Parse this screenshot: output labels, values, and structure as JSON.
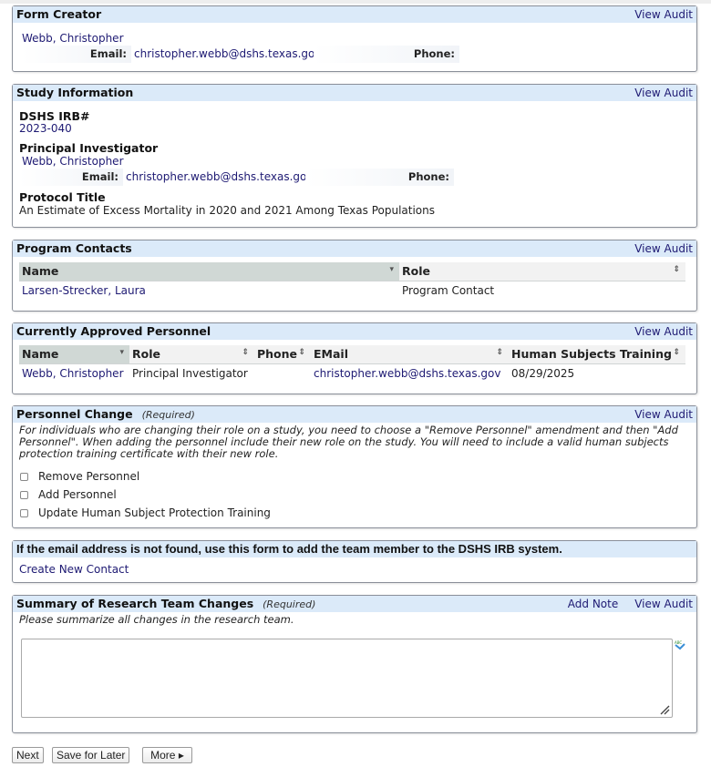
{
  "common": {
    "view_audit": "View Audit",
    "email_label": "Email:",
    "phone_label": "Phone:"
  },
  "form_creator": {
    "title": "Form Creator",
    "name": "Webb, Christopher",
    "email": "christopher.webb@dshs.texas.gov",
    "phone": ""
  },
  "study_info": {
    "title": "Study Information",
    "irb_label": "DSHS IRB#",
    "irb_value": "2023-040",
    "pi_label": "Principal Investigator",
    "pi_name": "Webb, Christopher",
    "pi_email": "christopher.webb@dshs.texas.gov",
    "pi_phone": "",
    "protocol_label": "Protocol Title",
    "protocol_value": "An Estimate of Excess Mortality in 2020 and 2021 Among Texas Populations"
  },
  "program_contacts": {
    "title": "Program Contacts",
    "columns": [
      "Name",
      "Role"
    ],
    "rows": [
      {
        "name": "Larsen-Strecker, Laura",
        "role": "Program Contact"
      }
    ]
  },
  "approved_personnel": {
    "title": "Currently Approved Personnel",
    "columns": [
      "Name",
      "Role",
      "Phone",
      "EMail",
      "Human Subjects Training"
    ],
    "rows": [
      {
        "name": "Webb, Christopher",
        "role": "Principal Investigator",
        "phone": "",
        "email": "christopher.webb@dshs.texas.gov",
        "training": "08/29/2025"
      }
    ]
  },
  "personnel_change": {
    "title": "Personnel Change",
    "required": "(Required)",
    "description": "For individuals who are changing their role on a study, you need to choose a \"Remove Personnel\" amendment and then \"Add Personnel\". When adding the personnel include their new role on the study. You will need to include a valid human subjects protection training certificate with their new role.",
    "options": [
      {
        "label": "Remove Personnel",
        "checked": false
      },
      {
        "label": "Add Personnel",
        "checked": false
      },
      {
        "label": "Update Human Subject Protection Training",
        "checked": false
      }
    ]
  },
  "new_contact": {
    "title": "If the email address is not found, use this form to add the team member to the DSHS IRB system.",
    "link": "Create New Contact"
  },
  "summary": {
    "title": "Summary of Research Team Changes",
    "required": "(Required)",
    "add_note": "Add Note",
    "prompt": "Please summarize all changes in the research team.",
    "value": ""
  },
  "buttons": {
    "next": "Next",
    "save_later": "Save for Later",
    "more": "More ▸"
  }
}
